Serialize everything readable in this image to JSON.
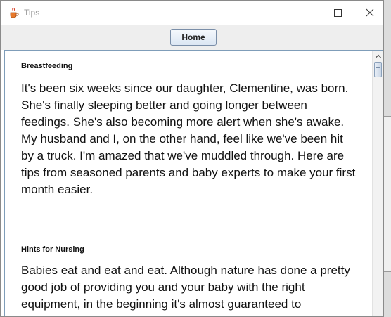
{
  "window": {
    "title": "Tips",
    "app_icon": "java-cup-icon",
    "controls": [
      "minimize-icon",
      "maximize-icon",
      "close-icon"
    ]
  },
  "toolbar": {
    "home_label": "Home"
  },
  "article": {
    "sections": [
      {
        "heading": "Breastfeeding",
        "body": "It's been six weeks since our daughter, Clementine, was born. She's finally sleeping better and going longer between feedings. She's also becoming more alert when she's awake. My husband and I, on the other hand, feel like we've been hit by a truck. I'm amazed that we've muddled through. Here are tips from seasoned parents and baby experts to make your first month easier."
      },
      {
        "heading": "Hints for Nursing",
        "body": "Babies eat and eat and eat. Although nature has done a pretty good job of providing you and your baby with the right equipment, in the beginning it's almost guaranteed to"
      }
    ]
  },
  "colors": {
    "button_border": "#7a8ea8",
    "panel_border": "#7f9db9",
    "title_text": "#9a9a9a"
  }
}
